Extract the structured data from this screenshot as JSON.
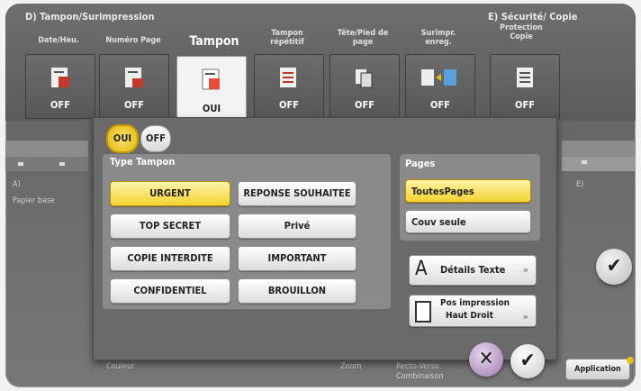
{
  "sections": {
    "d_label": "D)  Tampon/Surimpression",
    "e_label": "E)  Sécurité/ Copie"
  },
  "tabs": [
    {
      "label": "Date/Heu.",
      "status": "OFF",
      "icon": "date-stamp-icon"
    },
    {
      "label": "Numéro Page",
      "status": "OFF",
      "icon": "page-number-icon"
    },
    {
      "label": "Tampon",
      "status": "OUI",
      "icon": "stamp-icon",
      "active": true
    },
    {
      "label": "Tampon répétitif",
      "status": "OFF",
      "icon": "repeat-stamp-icon"
    },
    {
      "label": "Tête/Pied de page",
      "status": "OFF",
      "icon": "header-footer-icon"
    },
    {
      "label": "Surimpr. enreg.",
      "status": "OFF",
      "icon": "overlay-icon"
    },
    {
      "label": "Protection Copie",
      "status": "OFF",
      "icon": "copy-protect-icon"
    }
  ],
  "background": {
    "a_label": "A)",
    "papier": "Papier base",
    "e_short": "E)",
    "couleur": "Couleur",
    "zoom": "Zoom",
    "recto_verso": "Recto-Verso Combinaison",
    "application": "Application"
  },
  "toggle": {
    "on": "OUI",
    "off": "OFF"
  },
  "type_tampon": {
    "label": "Type Tampon",
    "items": [
      "URGENT",
      "REPONSE SOUHAITEE",
      "TOP SECRET",
      "Privé",
      "COPIE INTERDITE",
      "IMPORTANT",
      "CONFIDENTIEL",
      "BROUILLON"
    ],
    "selected": "URGENT"
  },
  "pages": {
    "label": "Pages",
    "items": [
      "ToutesPages",
      "Couv seule"
    ],
    "selected": "ToutesPages"
  },
  "details": {
    "label": "Détails Texte",
    "arrow": "»"
  },
  "position": {
    "title": "Pos impression",
    "value": "Haut Droit",
    "arrow": "»"
  },
  "actions": {
    "cancel": "✕",
    "ok": "✔"
  },
  "colors": {
    "selected": "#f3d230",
    "panel": "#8a8a8a"
  }
}
